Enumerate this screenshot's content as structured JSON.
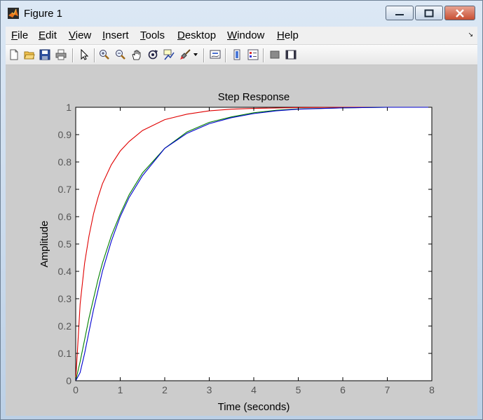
{
  "window": {
    "title": "Figure 1"
  },
  "menu": {
    "items": [
      {
        "u": "F",
        "rest": "ile"
      },
      {
        "u": "E",
        "rest": "dit"
      },
      {
        "u": "V",
        "rest": "iew"
      },
      {
        "u": "I",
        "rest": "nsert"
      },
      {
        "u": "T",
        "rest": "ools"
      },
      {
        "u": "D",
        "rest": "esktop"
      },
      {
        "u": "W",
        "rest": "indow"
      },
      {
        "u": "H",
        "rest": "elp"
      }
    ]
  },
  "toolbar": {
    "icons": [
      "new-figure-icon",
      "open-file-icon",
      "save-icon",
      "print-icon",
      "edit-plot-arrow-icon",
      "zoom-in-icon",
      "zoom-out-icon",
      "pan-hand-icon",
      "rotate-3d-icon",
      "data-cursor-icon",
      "brush-icon",
      "brush-dropdown-icon",
      "link-plot-icon",
      "insert-colorbar-icon",
      "insert-legend-icon",
      "hide-plot-tools-icon",
      "show-plot-tools-icon"
    ]
  },
  "chart_data": {
    "type": "line",
    "title": "Step Response",
    "xlabel": "Time (seconds)",
    "ylabel": "Amplitude",
    "xlim": [
      0,
      8
    ],
    "ylim": [
      0,
      1
    ],
    "x_ticks": [
      "0",
      "1",
      "2",
      "3",
      "4",
      "5",
      "6",
      "7",
      "8"
    ],
    "y_ticks": [
      "0",
      "0.1",
      "0.2",
      "0.3",
      "0.4",
      "0.5",
      "0.6",
      "0.7",
      "0.8",
      "0.9",
      "1"
    ],
    "grid": false,
    "reference_line": {
      "y": 1,
      "style": "dashed",
      "color": "#000000"
    },
    "series": [
      {
        "color": "#e00000",
        "x": [
          0,
          0.1,
          0.2,
          0.3,
          0.4,
          0.5,
          0.6,
          0.8,
          1.0,
          1.2,
          1.5,
          2.0,
          2.5,
          3.0,
          3.5,
          4.0,
          5.0,
          6.0,
          7.0,
          8.0
        ],
        "y": [
          0,
          0.28,
          0.43,
          0.53,
          0.61,
          0.67,
          0.72,
          0.79,
          0.84,
          0.875,
          0.915,
          0.955,
          0.975,
          0.987,
          0.993,
          0.996,
          0.999,
          1,
          1,
          1
        ]
      },
      {
        "color": "#008000",
        "x": [
          0,
          0.1,
          0.2,
          0.3,
          0.4,
          0.5,
          0.6,
          0.8,
          1.0,
          1.2,
          1.5,
          2.0,
          2.5,
          3.0,
          3.5,
          4.0,
          4.5,
          5.0,
          6.0,
          7.0,
          8.0
        ],
        "y": [
          0,
          0.07,
          0.15,
          0.23,
          0.3,
          0.37,
          0.43,
          0.53,
          0.61,
          0.68,
          0.76,
          0.85,
          0.91,
          0.945,
          0.965,
          0.98,
          0.989,
          0.994,
          0.998,
          1,
          1
        ]
      },
      {
        "color": "#0000d0",
        "x": [
          0,
          0.1,
          0.2,
          0.3,
          0.4,
          0.5,
          0.6,
          0.8,
          1.0,
          1.2,
          1.5,
          2.0,
          2.5,
          3.0,
          3.5,
          4.0,
          4.5,
          5.0,
          6.0,
          7.0,
          8.0
        ],
        "y": [
          0,
          0.03,
          0.1,
          0.18,
          0.26,
          0.33,
          0.4,
          0.51,
          0.6,
          0.67,
          0.75,
          0.85,
          0.905,
          0.94,
          0.962,
          0.977,
          0.987,
          0.993,
          0.998,
          1,
          1
        ]
      }
    ]
  }
}
